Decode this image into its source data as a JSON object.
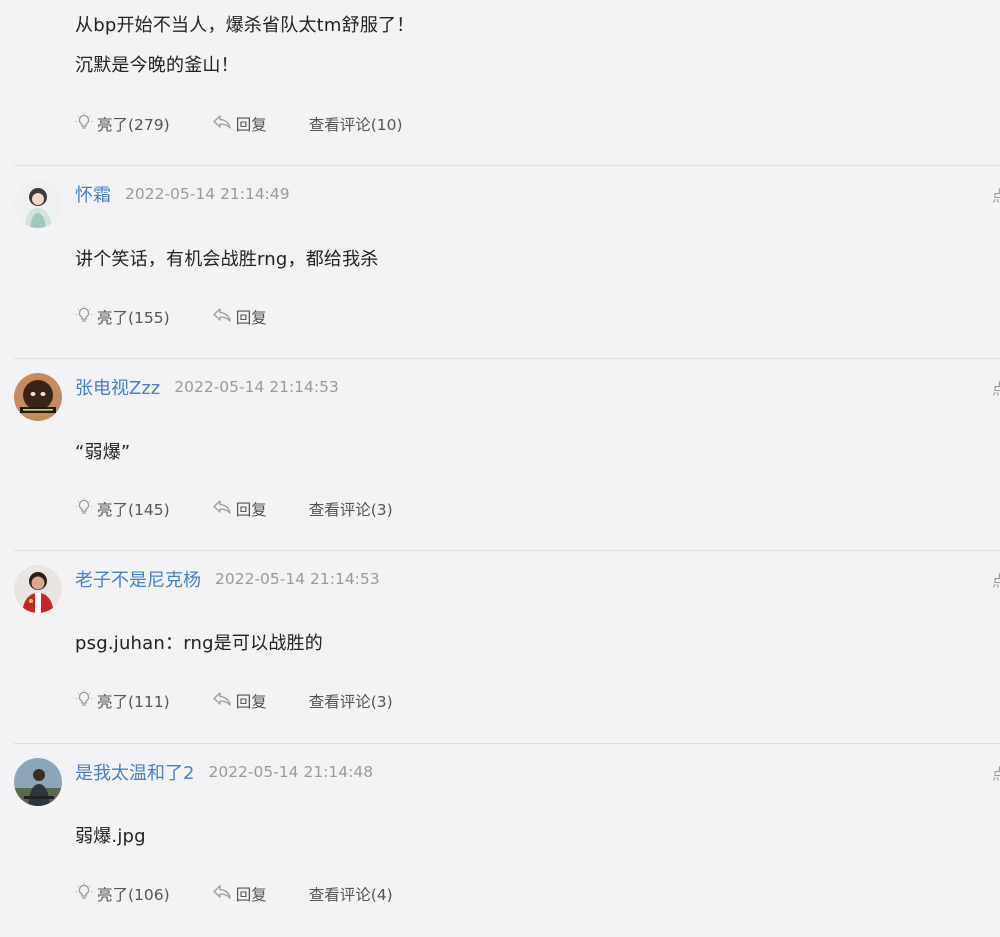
{
  "top_comment": {
    "lines": [
      "从bp开始不当人，爆杀省队太tm舒服了！",
      "沉默是今晚的釜山！"
    ],
    "likes": "亮了(279)",
    "reply": "回复",
    "view_comments": "查看评论(10)"
  },
  "comments": [
    {
      "username": "怀霜",
      "timestamp": "2022-05-14 21:14:49",
      "text": "讲个笑话，有机会战胜rng，都给我杀",
      "likes": "亮了(155)",
      "reply": "回复",
      "view_comments": ""
    },
    {
      "username": "张电视Zzz",
      "timestamp": "2022-05-14 21:14:53",
      "text": "“弱爆”",
      "likes": "亮了(145)",
      "reply": "回复",
      "view_comments": "查看评论(3)"
    },
    {
      "username": "老子不是尼克杨",
      "timestamp": "2022-05-14 21:14:53",
      "text": "psg.juhan：rng是可以战胜的",
      "likes": "亮了(111)",
      "reply": "回复",
      "view_comments": "查看评论(3)"
    },
    {
      "username": "是我太温和了2",
      "timestamp": "2022-05-14 21:14:48",
      "text": "弱爆.jpg",
      "likes": "亮了(106)",
      "reply": "回复",
      "view_comments": "查看评论(4)"
    }
  ],
  "edge_label": "点",
  "colors": {
    "background": "#f3f3f5",
    "username": "#4a7fc0",
    "timestamp": "#9a9a9a",
    "action_text": "#555555",
    "divider": "#dedede"
  },
  "icons": {
    "like": "lightbulb-icon",
    "reply": "reply-arrow-icon"
  }
}
